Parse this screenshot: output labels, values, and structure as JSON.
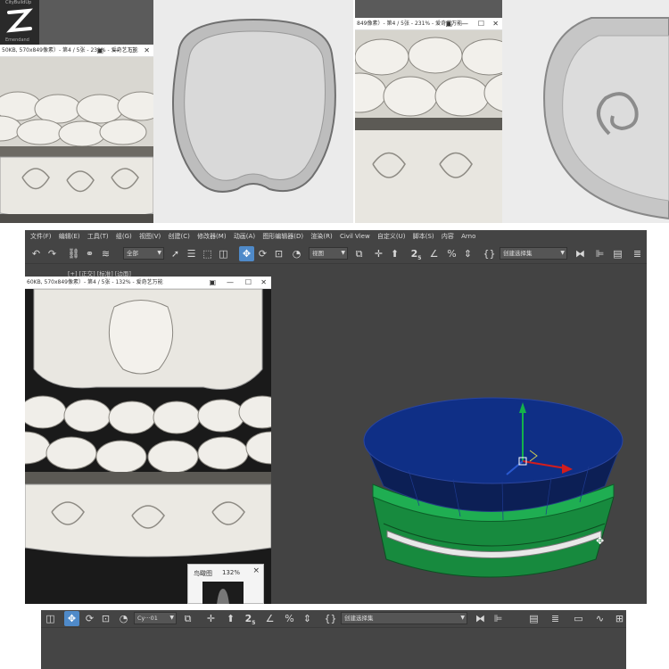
{
  "top_left": {
    "logo_title": "CityBuildUp",
    "logo_subtitle": "Emendand",
    "image_window_title": "50KB, 570x849像素）- 第4 / 5张 - 231% - 爱奇艺万能",
    "controls": [
      "▣",
      "—",
      "☐",
      "✕"
    ]
  },
  "top_right": {
    "image_window_title": "849像素）- 第4 / 5张 - 231% - 爱奇艺万能",
    "controls": [
      "▣",
      "—",
      "☐",
      "✕"
    ]
  },
  "max": {
    "menu": [
      "文件(F)",
      "编辑(E)",
      "工具(T)",
      "组(G)",
      "视图(V)",
      "创建(C)",
      "修改器(M)",
      "动画(A)",
      "图形编辑器(D)",
      "渲染(R)",
      "Civil View",
      "自定义(U)",
      "脚本(S)",
      "内容",
      "Arno"
    ],
    "selection_filter": "全部",
    "reference_coord": "视图",
    "named_selection": "创建选择集",
    "viewport_label": "[+] [正交] [标准] [边面]",
    "image_window_title": "60KB, 570x849像素）- 第4 / 5张 - 132% - 爱奇艺万能",
    "controls": [
      "▣",
      "—",
      "☐",
      "✕"
    ],
    "navigator_title": "鸟瞰图",
    "navigator_zoom": "132%",
    "navigator_close": "×",
    "snap_label": "2",
    "snap_sub": "5"
  },
  "bottom": {
    "reference_coord": "Cy···01",
    "named_selection": "创建选择集",
    "snap_label": "2",
    "snap_sub": "5"
  },
  "colors": {
    "viewport_bg": "#434343",
    "active_tool": "#4f8ac9",
    "cylinder_top": "#0e2f86",
    "cylinder_side": "#1a9c46"
  }
}
